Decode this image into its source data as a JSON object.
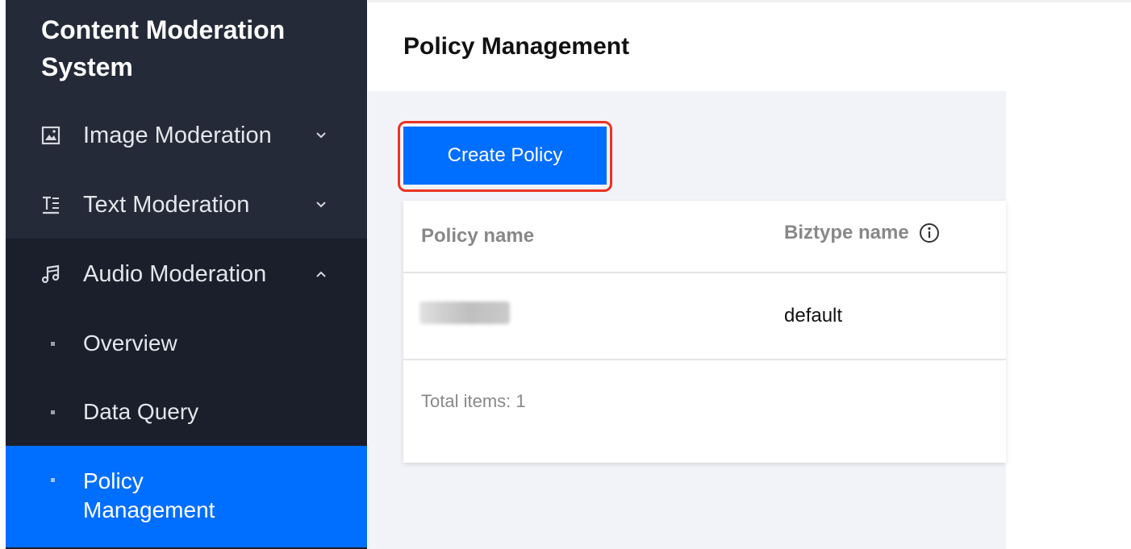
{
  "sidebar": {
    "brand": "Content Moderation System",
    "menus": [
      {
        "label": "Image Moderation",
        "icon": "image-icon",
        "chevron": "chevron-down-icon"
      },
      {
        "label": "Text Moderation",
        "icon": "text-icon",
        "chevron": "chevron-down-icon"
      },
      {
        "label": "Audio Moderation",
        "icon": "music-icon",
        "chevron": "chevron-up-icon"
      }
    ],
    "submenu": [
      {
        "label": "Overview"
      },
      {
        "label": "Data Query"
      },
      {
        "label": "Policy Management",
        "active": true
      }
    ]
  },
  "header": {
    "title": "Policy Management"
  },
  "toolbar": {
    "create_label": "Create Policy"
  },
  "table": {
    "columns": [
      {
        "label": "Policy name"
      },
      {
        "label": "Biztype name",
        "icon": "info-icon"
      }
    ],
    "rows": [
      {
        "policy_name": "",
        "biztype_name": "default"
      }
    ],
    "total_label": "Total items:  1"
  },
  "colors": {
    "sidebar_bg": "#242a37",
    "submenu_bg": "#1b1f2b",
    "accent": "#006eff",
    "highlight": "#ea3323"
  }
}
